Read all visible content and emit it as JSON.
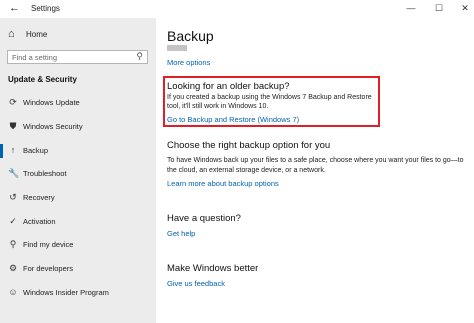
{
  "window": {
    "title": "Settings",
    "back_glyph": "←",
    "minimize_glyph": "—",
    "maximize_glyph": "☐",
    "close_glyph": "✕"
  },
  "sidebar": {
    "home_label": "Home",
    "home_icon": "home-icon",
    "search_placeholder": "Find a setting",
    "section_title": "Update & Security",
    "items": [
      {
        "label": "Windows Update",
        "icon": "sync-icon",
        "glyph": "⟳",
        "selected": false
      },
      {
        "label": "Windows Security",
        "icon": "shield-icon",
        "glyph": "⛊",
        "selected": false
      },
      {
        "label": "Backup",
        "icon": "backup-arrow-icon",
        "glyph": "↑",
        "selected": true
      },
      {
        "label": "Troubleshoot",
        "icon": "wrench-icon",
        "glyph": "🔧",
        "selected": false
      },
      {
        "label": "Recovery",
        "icon": "recovery-icon",
        "glyph": "↺",
        "selected": false
      },
      {
        "label": "Activation",
        "icon": "check-circle-icon",
        "glyph": "✓",
        "selected": false
      },
      {
        "label": "Find my device",
        "icon": "person-pin-icon",
        "glyph": "⚲",
        "selected": false
      },
      {
        "label": "For developers",
        "icon": "developer-tools-icon",
        "glyph": "⚙",
        "selected": false
      },
      {
        "label": "Windows Insider Program",
        "icon": "insider-icon",
        "glyph": "☺",
        "selected": false
      }
    ]
  },
  "main": {
    "title": "Backup",
    "more_options": "More options",
    "older_backup": {
      "title": "Looking for an older backup?",
      "description": "If you created a backup using the Windows 7 Backup and Restore tool, it'll still work in Windows 10.",
      "link": "Go to Backup and Restore (Windows 7)"
    },
    "choose": {
      "title": "Choose the right backup option for you",
      "description": "To have Windows back up your files to a safe place, choose where you want your files to go—to the cloud, an external storage device, or a network.",
      "link": "Learn more about backup options"
    },
    "question": {
      "title": "Have a question?",
      "link": "Get help"
    },
    "better": {
      "title": "Make Windows better",
      "link": "Give us feedback"
    }
  },
  "colors": {
    "accent": "#0063b1",
    "highlight": "#e01e25",
    "sidebar_bg": "#ececec"
  }
}
